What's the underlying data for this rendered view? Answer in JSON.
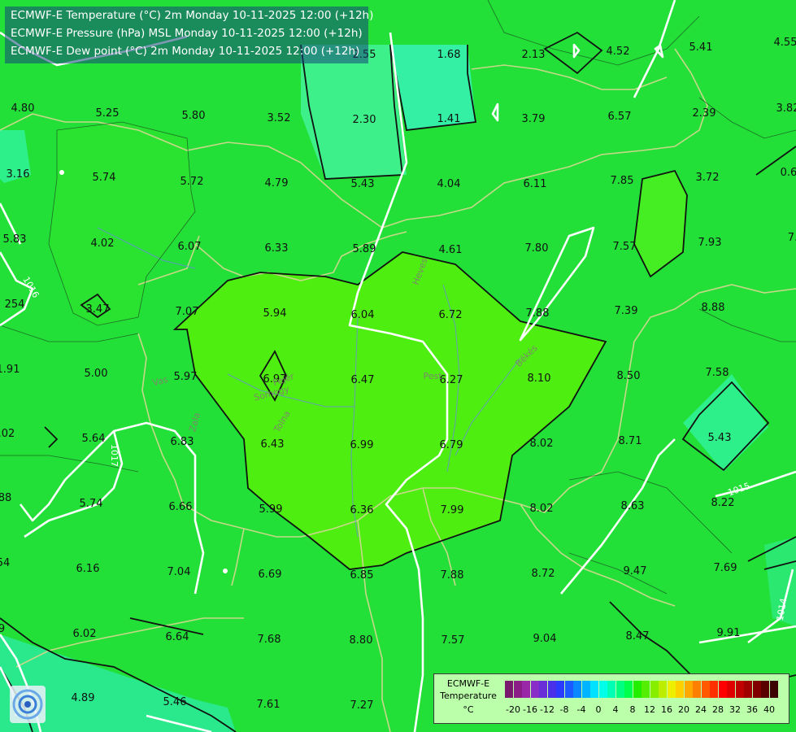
{
  "header": {
    "lines": [
      "ECMWF-E Temperature (°C) 2m Monday 10-11-2025 12:00 (+12h)",
      "ECMWF-E Pressure (hPa) MSL Monday 10-11-2025 12:00 (+12h)",
      "ECMWF-E Dew point (°C) 2m Monday 10-11-2025 12:00 (+12h)"
    ]
  },
  "map": {
    "temperature_values": [
      "2.55",
      "1.68",
      "2.13",
      "4.52",
      "5.41",
      "4.55",
      "4.80",
      "5.25",
      "5.80",
      "3.52",
      "2.30",
      "1.41",
      "3.79",
      "6.57",
      "2.39",
      "3.82",
      "3.16",
      "5.74",
      "5.72",
      "4.79",
      "5.43",
      "4.04",
      "6.11",
      "7.85",
      "3.72",
      "0.6",
      "5.83",
      "4.02",
      "6.07",
      "6.33",
      "5.89",
      "4.61",
      "7.80",
      "7.57",
      "7.93",
      "7.",
      "3.47",
      "7.07",
      "5.94",
      "6.04",
      "6.72",
      "7.88",
      "7.39",
      "8.88",
      "254",
      "1.91",
      "5.00",
      "5.97",
      "6.97",
      "6.47",
      "6.27",
      "8.10",
      "8.50",
      "7.58",
      ".02",
      "5.64",
      "6.83",
      "6.43",
      "6.99",
      "6.79",
      "8.02",
      "8.71",
      "5.43",
      "88",
      "5.74",
      "6.66",
      "5.99",
      "6.36",
      "7.99",
      "8.02",
      "8.63",
      "8.22",
      "54",
      "6.16",
      "7.04",
      "6.69",
      "6.85",
      "7.88",
      "8.72",
      "9.47",
      "7.69",
      "9",
      "6.02",
      "6.64",
      "7.68",
      "8.80",
      "7.57",
      "9.04",
      "8.47",
      "9.91",
      "4.89",
      "5.46",
      "7.61",
      "7.27"
    ],
    "isobar_labels": [
      "1016",
      "1017",
      "1015",
      "1014"
    ],
    "place_labels": [
      "Heves",
      "Békés",
      "Vas",
      "Tolna",
      "Somogy",
      "Fejér",
      "Zala",
      "Pest"
    ]
  },
  "legend": {
    "title": "ECMWF-E",
    "subtitle": "Temperature",
    "unit": "°C",
    "tick_labels": [
      "-20",
      "-16",
      "-12",
      "-8",
      "-4",
      "0",
      "4",
      "8",
      "12",
      "16",
      "20",
      "24",
      "28",
      "32",
      "36",
      "40"
    ],
    "colors": [
      "#7a1a6e",
      "#8c1e88",
      "#9a28a8",
      "#8a2ec8",
      "#6a2ed8",
      "#4a30e8",
      "#2a3aff",
      "#1a5aff",
      "#0a88ff",
      "#00b4ff",
      "#00e0ff",
      "#00ffe8",
      "#00ffb4",
      "#00ff80",
      "#00ff4a",
      "#22ee00",
      "#55ee00",
      "#88ee00",
      "#bbee00",
      "#eeee00",
      "#ffd000",
      "#ffa800",
      "#ff8000",
      "#ff5a00",
      "#ff3000",
      "#ff0000",
      "#e00000",
      "#c00000",
      "#a00000",
      "#800000",
      "#5a0000",
      "#3c0000"
    ]
  },
  "logo": {
    "icon": "ecmwf-swirl-icon"
  }
}
